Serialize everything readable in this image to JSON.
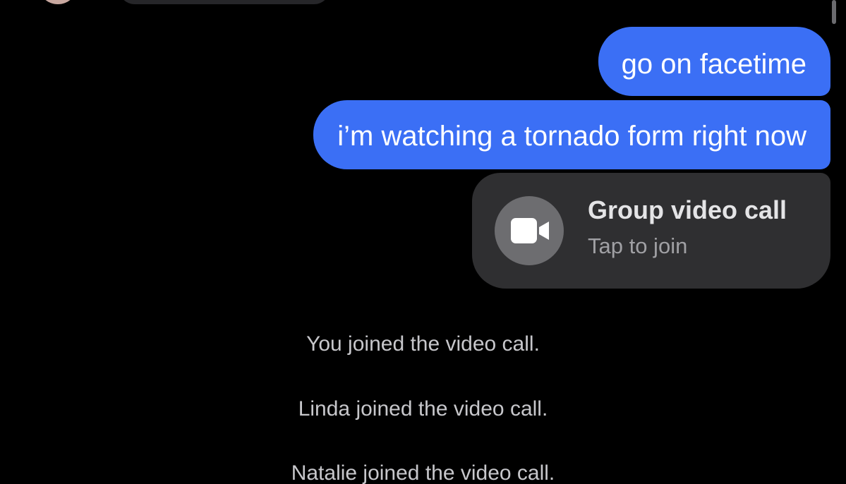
{
  "thread": {
    "messages": [
      {
        "text": "go on facetime"
      },
      {
        "text": "i’m watching a tornado form right now"
      }
    ],
    "call_card": {
      "title": "Group video call",
      "subtitle": "Tap to join",
      "icon": "video-camera-icon"
    },
    "events": [
      "You joined the video call.",
      "Linda joined the video call.",
      "Natalie joined the video call."
    ]
  },
  "colors": {
    "background": "#000000",
    "outgoing_bubble": "#3b6ff5",
    "call_card": "#2f2f31",
    "icon_circle": "#6d6d70",
    "event_text": "#c7c7cb"
  }
}
